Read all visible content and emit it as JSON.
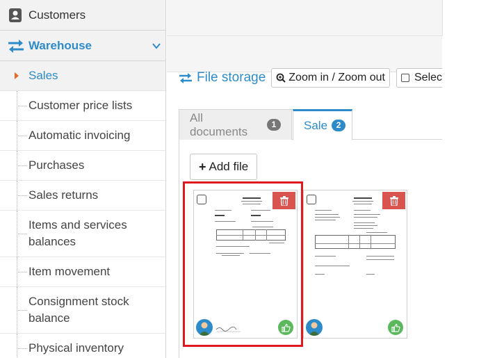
{
  "sidebar": {
    "customers_label": "Customers",
    "warehouse_label": "Warehouse",
    "items": [
      {
        "label": "Sales",
        "active": true
      },
      {
        "label": "Customer price lists"
      },
      {
        "label": "Automatic invoicing"
      },
      {
        "label": "Purchases"
      },
      {
        "label": "Sales returns"
      },
      {
        "label": "Items and services balances"
      },
      {
        "label": "Item movement"
      },
      {
        "label": "Consignment stock balance"
      },
      {
        "label": "Physical inventory"
      }
    ]
  },
  "storage": {
    "title": "File storage",
    "zoom_label": "Zoom in / Zoom out",
    "select_label": "Select all"
  },
  "tabs": [
    {
      "label": "All documents",
      "count": "1"
    },
    {
      "label": "Sale",
      "count": "2"
    }
  ],
  "panel": {
    "add_file_label": "Add file"
  },
  "colors": {
    "accent": "#2e8bc9",
    "delete": "#d9534f",
    "approve": "#5cb85c",
    "highlight": "#e0191e",
    "caret": "#e06b2b"
  },
  "icons": {
    "customers": "address-book-icon",
    "warehouse": "exchange-arrows-icon",
    "storage": "exchange-arrows-icon",
    "zoom": "zoom-icon",
    "delete": "trash-icon",
    "approve": "thumbs-up-icon"
  }
}
